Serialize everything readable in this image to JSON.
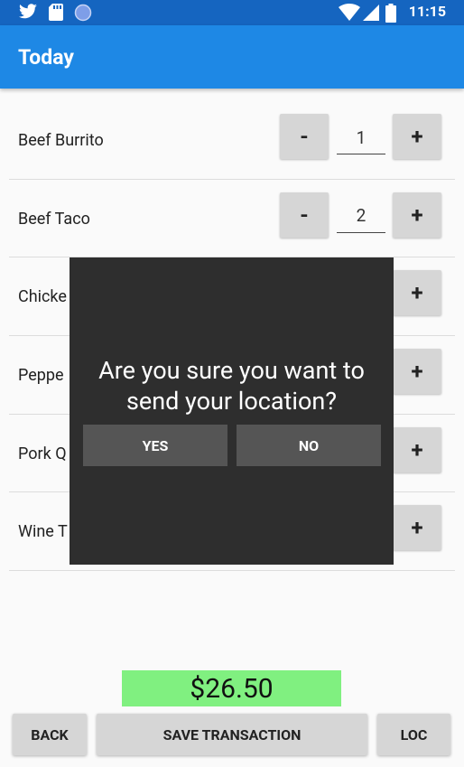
{
  "status_bar": {
    "time": "11:15",
    "icons": [
      "twitter-icon",
      "sd-card-icon",
      "circle-icon",
      "wifi-icon",
      "signal-icon",
      "battery-icon"
    ]
  },
  "app_bar": {
    "title": "Today"
  },
  "items": [
    {
      "name": "Beef Burrito",
      "qty": "1"
    },
    {
      "name": "Beef Taco",
      "qty": "2"
    },
    {
      "name": "Chicke",
      "qty": ""
    },
    {
      "name": "Peppe",
      "qty": ""
    },
    {
      "name": "Pork Q",
      "qty": ""
    },
    {
      "name": "Wine T",
      "qty": ""
    }
  ],
  "stepper": {
    "minus": "-",
    "plus": "+"
  },
  "dialog": {
    "message": "Are you sure you want to send your location?",
    "yes": "YES",
    "no": "NO"
  },
  "footer": {
    "total": "$26.50",
    "back": "BACK",
    "save": "SAVE TRANSACTION",
    "loc": "LOC"
  },
  "colors": {
    "status_bar": "#1565c0",
    "app_bar": "#1e88e5",
    "total_bg": "#80f080",
    "dialog_bg": "#2e2e2e",
    "dialog_button": "#555555"
  }
}
